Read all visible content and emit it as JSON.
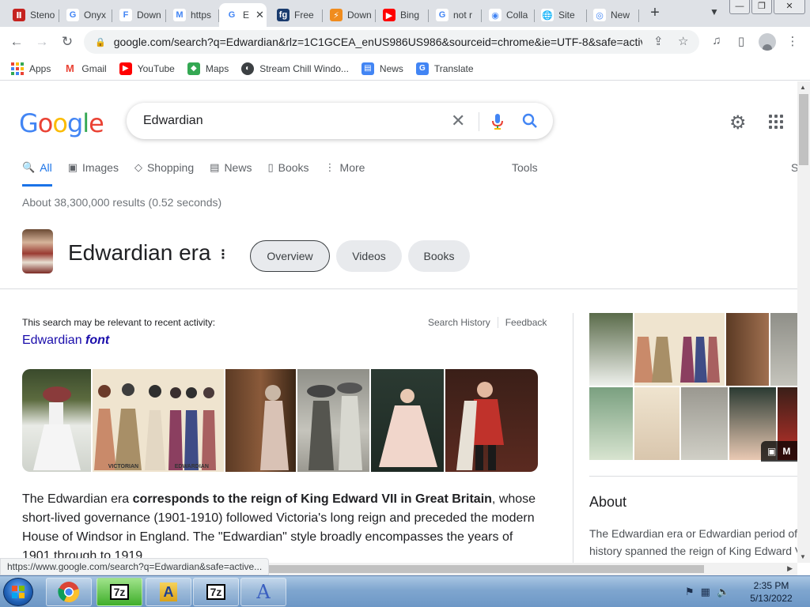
{
  "tabs": [
    {
      "title": "Steno",
      "favicon": "steno-icon",
      "color": "#c5221f",
      "glyph": "Ⅱ"
    },
    {
      "title": "Onyx",
      "favicon": "google-icon",
      "color": "#ffffff",
      "glyph": "G"
    },
    {
      "title": "Down",
      "favicon": "font-icon",
      "color": "#ffffff",
      "glyph": "F"
    },
    {
      "title": "https",
      "favicon": "medium-icon",
      "color": "#ffffff",
      "glyph": "M"
    },
    {
      "title": "E",
      "favicon": "google-icon",
      "color": "#ffffff",
      "glyph": "G",
      "active": true
    },
    {
      "title": "Free",
      "favicon": "fg-icon",
      "color": "#1a3b6e",
      "glyph": "fg"
    },
    {
      "title": "Down",
      "favicon": "download-icon",
      "color": "#f08c1e",
      "glyph": "⚡"
    },
    {
      "title": "Bing",
      "favicon": "youtube-icon",
      "color": "#ff0000",
      "glyph": "▶"
    },
    {
      "title": "not r",
      "favicon": "google-icon",
      "color": "#ffffff",
      "glyph": "G"
    },
    {
      "title": "Colla",
      "favicon": "collab-icon",
      "color": "#ffffff",
      "glyph": "◉"
    },
    {
      "title": "Site",
      "favicon": "globe-icon",
      "color": "#ffffff",
      "glyph": "🌐"
    },
    {
      "title": "New",
      "favicon": "chrome-icon",
      "color": "#ffffff",
      "glyph": "◎"
    }
  ],
  "address": {
    "url": "google.com/search?q=Edwardian&rlz=1C1GCEA_enUS986US986&sourceid=chrome&ie=UTF-8&safe=activ..."
  },
  "bookmarks": [
    {
      "label": "Apps",
      "icon": "apps-grid-icon",
      "color": "#4285f4"
    },
    {
      "label": "Gmail",
      "icon": "gmail-icon",
      "color": "#ea4335"
    },
    {
      "label": "YouTube",
      "icon": "youtube-icon",
      "color": "#ff0000"
    },
    {
      "label": "Maps",
      "icon": "maps-icon",
      "color": "#34a853"
    },
    {
      "label": "Stream Chill Windo...",
      "icon": "stream-icon",
      "color": "#3c4043"
    },
    {
      "label": "News",
      "icon": "news-icon",
      "color": "#4285f4"
    },
    {
      "label": "Translate",
      "icon": "translate-icon",
      "color": "#4285f4"
    }
  ],
  "logo": {
    "letters": [
      {
        "ch": "G",
        "color": "#4285f4"
      },
      {
        "ch": "o",
        "color": "#ea4335"
      },
      {
        "ch": "o",
        "color": "#fbbc05"
      },
      {
        "ch": "g",
        "color": "#4285f4"
      },
      {
        "ch": "l",
        "color": "#34a853"
      },
      {
        "ch": "e",
        "color": "#ea4335"
      }
    ]
  },
  "search": {
    "query": "Edwardian"
  },
  "search_tabs": [
    {
      "label": "All",
      "icon": "search-icon",
      "glyph": "🔍",
      "active": true
    },
    {
      "label": "Images",
      "icon": "image-icon",
      "glyph": "▣"
    },
    {
      "label": "Shopping",
      "icon": "tag-icon",
      "glyph": "◇"
    },
    {
      "label": "News",
      "icon": "news-icon",
      "glyph": "▤"
    },
    {
      "label": "Books",
      "icon": "book-icon",
      "glyph": "▯"
    },
    {
      "label": "More",
      "icon": "more-icon",
      "glyph": "⋮"
    }
  ],
  "tools_label": "Tools",
  "right_edge_text": "S",
  "result_stats": "About 38,300,000 results (0.52 seconds)",
  "knowledge_panel": {
    "title": "Edwardian era",
    "chips": [
      "Overview",
      "Videos",
      "Books"
    ]
  },
  "recent_activity": {
    "label": "This search may be relevant to recent activity:",
    "links": [
      "Search History",
      "Feedback"
    ],
    "suggestion_plain": "Edwardian ",
    "suggestion_bold": "font"
  },
  "image_strip_captions": [
    "VICTORIAN",
    "EDWARDIAN"
  ],
  "snippet": {
    "pre": "The Edwardian era ",
    "bold": "corresponds to the reign of King Edward VII in Great Britain",
    "post": ", whose short-lived governance (1901-1910) followed Victoria's long reign and preceded the modern House of Windsor in England. The \"Edwardian\" style broadly encompasses the years of 1901 through to 1919."
  },
  "right_panel": {
    "more_label": "M",
    "about_heading": "About",
    "about_lines": [
      "The Edwardian era or Edwardian period of",
      "history spanned the reign of King Edward V"
    ]
  },
  "status_bar": "https://www.google.com/search?q=Edwardian&safe=active...",
  "taskbar": {
    "apps": [
      {
        "name": "chrome",
        "icon": "chrome-icon"
      },
      {
        "name": "7zip",
        "icon": "7zip-icon",
        "label": "7z"
      },
      {
        "name": "font-manager",
        "icon": "font-folder-icon",
        "label": "A"
      },
      {
        "name": "7zip-2",
        "icon": "7zip-icon",
        "label": "7z"
      },
      {
        "name": "font-viewer",
        "icon": "font-viewer-icon",
        "label": "A"
      }
    ],
    "time": "2:35 PM",
    "date": "5/13/2022"
  }
}
